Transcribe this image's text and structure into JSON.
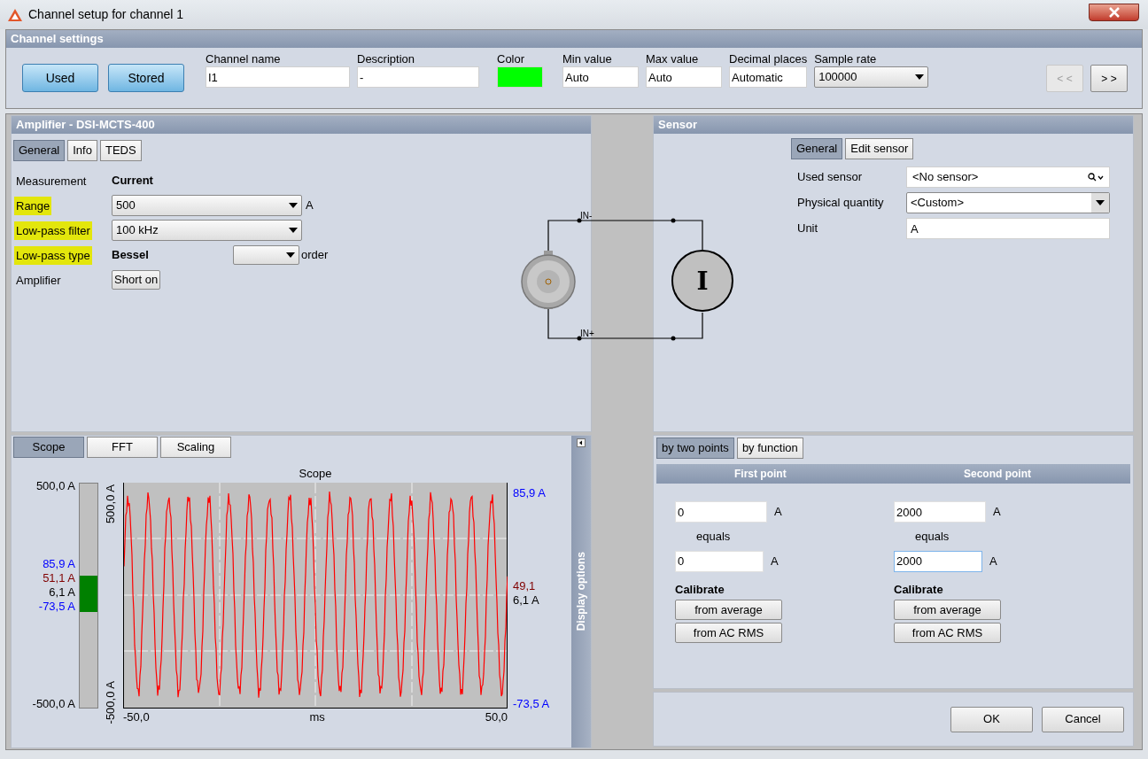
{
  "window": {
    "title": "Channel setup for channel 1"
  },
  "channel_settings": {
    "title": "Channel settings",
    "toggles": [
      {
        "label": "Used",
        "on": true
      },
      {
        "label": "Stored",
        "on": true
      }
    ],
    "fields": [
      {
        "label": "Channel name",
        "kind": "text",
        "value": "I1"
      },
      {
        "label": "Description",
        "kind": "text",
        "value": "-"
      },
      {
        "label": "Color",
        "kind": "color",
        "color": "#00ff00"
      },
      {
        "label": "Min value",
        "kind": "text",
        "value": "Auto"
      },
      {
        "label": "Max value",
        "kind": "text",
        "value": "Auto"
      },
      {
        "label": "Decimal places",
        "kind": "text",
        "value": "Automatic"
      },
      {
        "label": "Sample rate",
        "kind": "dropdown",
        "value": "100000"
      }
    ],
    "nav": [
      {
        "label": "< <",
        "disabled": true
      },
      {
        "label": "> >",
        "disabled": false
      }
    ]
  },
  "amplifier": {
    "title": "Amplifier - DSI-MCTS-400",
    "tabs": [
      {
        "label": "General",
        "selected": true
      },
      {
        "label": "Info",
        "selected": false
      },
      {
        "label": "TEDS",
        "selected": false
      }
    ],
    "rows": [
      {
        "label": "Measurement",
        "kind": "value",
        "value": "Current",
        "highlighted": false
      },
      {
        "label": "Range",
        "kind": "dropdown",
        "value": "500",
        "unit": "A",
        "highlighted": true
      },
      {
        "label": "Low-pass filter",
        "kind": "dropdown",
        "value": "100 kHz",
        "highlighted": true
      },
      {
        "label": "Low-pass type",
        "kind": "order",
        "value": "Bessel",
        "suffix": "order",
        "highlighted": true
      },
      {
        "label": "Amplifier",
        "kind": "button",
        "value": "Short on",
        "highlighted": false
      }
    ]
  },
  "diagram": {
    "top_label": "IN-",
    "bottom_label": "IN+",
    "source_symbol": "I"
  },
  "sensor": {
    "title": "Sensor",
    "tabs": [
      {
        "label": "General",
        "selected": true
      },
      {
        "label": "Edit sensor",
        "selected": false
      }
    ],
    "rows": [
      {
        "label": "Used sensor",
        "kind": "search",
        "value": "<No sensor>"
      },
      {
        "label": "Physical quantity",
        "kind": "dropdown",
        "value": "<Custom>"
      },
      {
        "label": "Unit",
        "kind": "text",
        "value": "A"
      }
    ]
  },
  "scope": {
    "tabs": [
      {
        "label": "Scope",
        "selected": true
      },
      {
        "label": "FFT",
        "selected": false
      },
      {
        "label": "Scaling",
        "selected": false
      }
    ],
    "title": "Scope",
    "bar_top": "500,0 A",
    "bar_bottom": "-500,0 A",
    "bar_markers": [
      {
        "text": "85,9 A",
        "color": "#0000ff"
      },
      {
        "text": "51,1 A",
        "color": "#800000"
      },
      {
        "text": "6,1 A",
        "color": "#000000"
      },
      {
        "text": "-73,5 A",
        "color": "#0000ff"
      }
    ],
    "axis_top": "500,0 A",
    "axis_bottom": "-500,0 A",
    "right_top": "85,9 A",
    "right_markers": [
      {
        "text": "49,1",
        "color": "#800000"
      },
      {
        "text": "6,1 A",
        "color": "#000000"
      }
    ],
    "right_bottom": "-73,5 A",
    "x_start": "-50,0",
    "x_unit": "ms",
    "x_end": "50,0",
    "display_options": "Display options"
  },
  "calibration": {
    "tabs": [
      {
        "label": "by two points",
        "selected": true
      },
      {
        "label": "by function",
        "selected": false
      }
    ],
    "points": [
      {
        "title": "First point",
        "input": "0",
        "input_unit": "A",
        "equals": "equals",
        "output": "0",
        "output_unit": "A",
        "focused": false,
        "calibrate": "Calibrate",
        "buttons": [
          "from average",
          "from AC RMS"
        ]
      },
      {
        "title": "Second point",
        "input": "2000",
        "input_unit": "A",
        "equals": "equals",
        "output": "2000",
        "output_unit": "A",
        "focused": true,
        "calibrate": "Calibrate",
        "buttons": [
          "from average",
          "from AC RMS"
        ]
      }
    ]
  },
  "footer": {
    "buttons": [
      "OK",
      "Cancel"
    ]
  }
}
